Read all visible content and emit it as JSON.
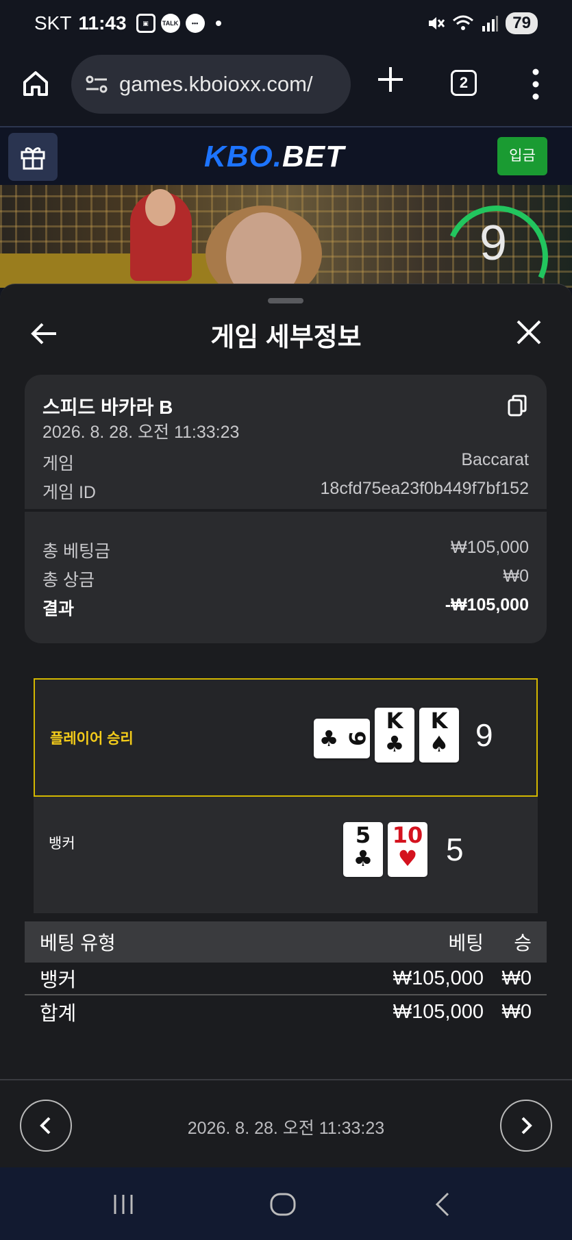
{
  "status_bar": {
    "carrier": "SKT",
    "time": "11:43",
    "notif_talk": "TALK",
    "battery": "79"
  },
  "browser": {
    "url": "games.kboioxx.com/",
    "tab_count": "2"
  },
  "site": {
    "logo_part1": "KBO.",
    "logo_part2": "BET",
    "deposit_label": "입금"
  },
  "video": {
    "timer": "9",
    "timer_color": "#22c55e"
  },
  "sheet": {
    "title": "게임 세부정보",
    "game_name": "스피드 바카라 B",
    "game_datetime": "2026. 8. 28. 오전 11:33:23",
    "rows": [
      {
        "label": "게임",
        "value": "Baccarat"
      },
      {
        "label": "게임 ID",
        "value": "18cfd75ea23f0b449f7bf152"
      }
    ],
    "totals": [
      {
        "label": "총 베팅금",
        "value": "₩105,000"
      },
      {
        "label": "총 상금",
        "value": "₩0"
      },
      {
        "label": "결과",
        "value": "-₩105,000"
      }
    ]
  },
  "results": {
    "player": {
      "label": "플레이어 승리",
      "score": "9",
      "cards": [
        {
          "rank": "9",
          "suit": "♣",
          "color": "black",
          "rotated": true
        },
        {
          "rank": "K",
          "suit": "♣",
          "color": "black",
          "rotated": false
        },
        {
          "rank": "K",
          "suit": "♠",
          "color": "black",
          "rotated": false
        }
      ]
    },
    "banker": {
      "label": "뱅커",
      "score": "5",
      "cards": [
        {
          "rank": "5",
          "suit": "♣",
          "color": "black"
        },
        {
          "rank": "10",
          "suit": "♥",
          "color": "red"
        }
      ]
    }
  },
  "bet_table": {
    "headers": [
      "베팅 유형",
      "베팅",
      "승"
    ],
    "rows": [
      [
        "뱅커",
        "₩105,000",
        "₩0"
      ],
      [
        "합계",
        "₩105,000",
        "₩0"
      ]
    ]
  },
  "footer_nav": {
    "date": "2026. 8. 28. 오전 11:33:23"
  },
  "colors": {
    "accent_blue": "#1d74ff",
    "deposit_green": "#1a9b32",
    "winner_gold": "#f4cc1a",
    "card_red": "#d4121e"
  }
}
